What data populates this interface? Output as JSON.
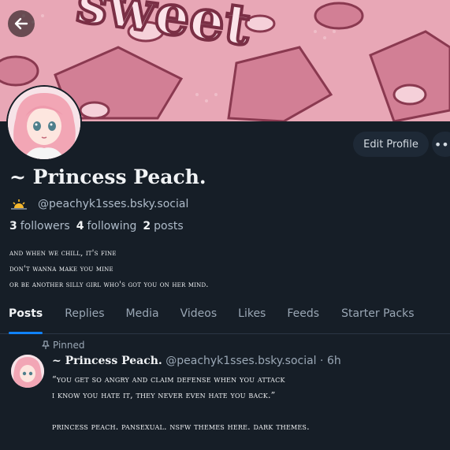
{
  "header": {
    "back_icon": "arrow-left-icon",
    "banner_text": "sweet"
  },
  "profile": {
    "name": "~ Princess Peach.",
    "handle_icon": "sun-icon",
    "handle": "@peachyk1sses.bsky.social",
    "edit_label": "Edit Profile",
    "more_icon": "ellipsis-icon",
    "followers_count": "3",
    "followers_label": "followers",
    "following_count": "4",
    "following_label": "following",
    "posts_count": "2",
    "posts_label": "posts",
    "bio_lines": [
      "and when we chill, it's fine",
      "don't wanna make you mine",
      "or be another silly girl who's got you on her mind."
    ]
  },
  "tabs": [
    {
      "label": "Posts",
      "active": true
    },
    {
      "label": "Replies"
    },
    {
      "label": "Media"
    },
    {
      "label": "Videos"
    },
    {
      "label": "Likes"
    },
    {
      "label": "Feeds"
    },
    {
      "label": "Starter Packs"
    }
  ],
  "pinned_post": {
    "pinned_label": "Pinned",
    "pin_icon": "pin-icon",
    "author_name": "~ Princess Peach.",
    "author_handle": "@peachyk1sses.bsky.social",
    "separator": "·",
    "time": "6h",
    "lines": [
      "“you get so angry and claim defense when you attack",
      "i know you hate it, they never even hate you back.”",
      "",
      "princess peach. pansexual. nsfw themes here. dark themes."
    ]
  },
  "colors": {
    "background": "#161e27",
    "accent": "#1083fe",
    "banner_pink": "#e7a4b4"
  }
}
